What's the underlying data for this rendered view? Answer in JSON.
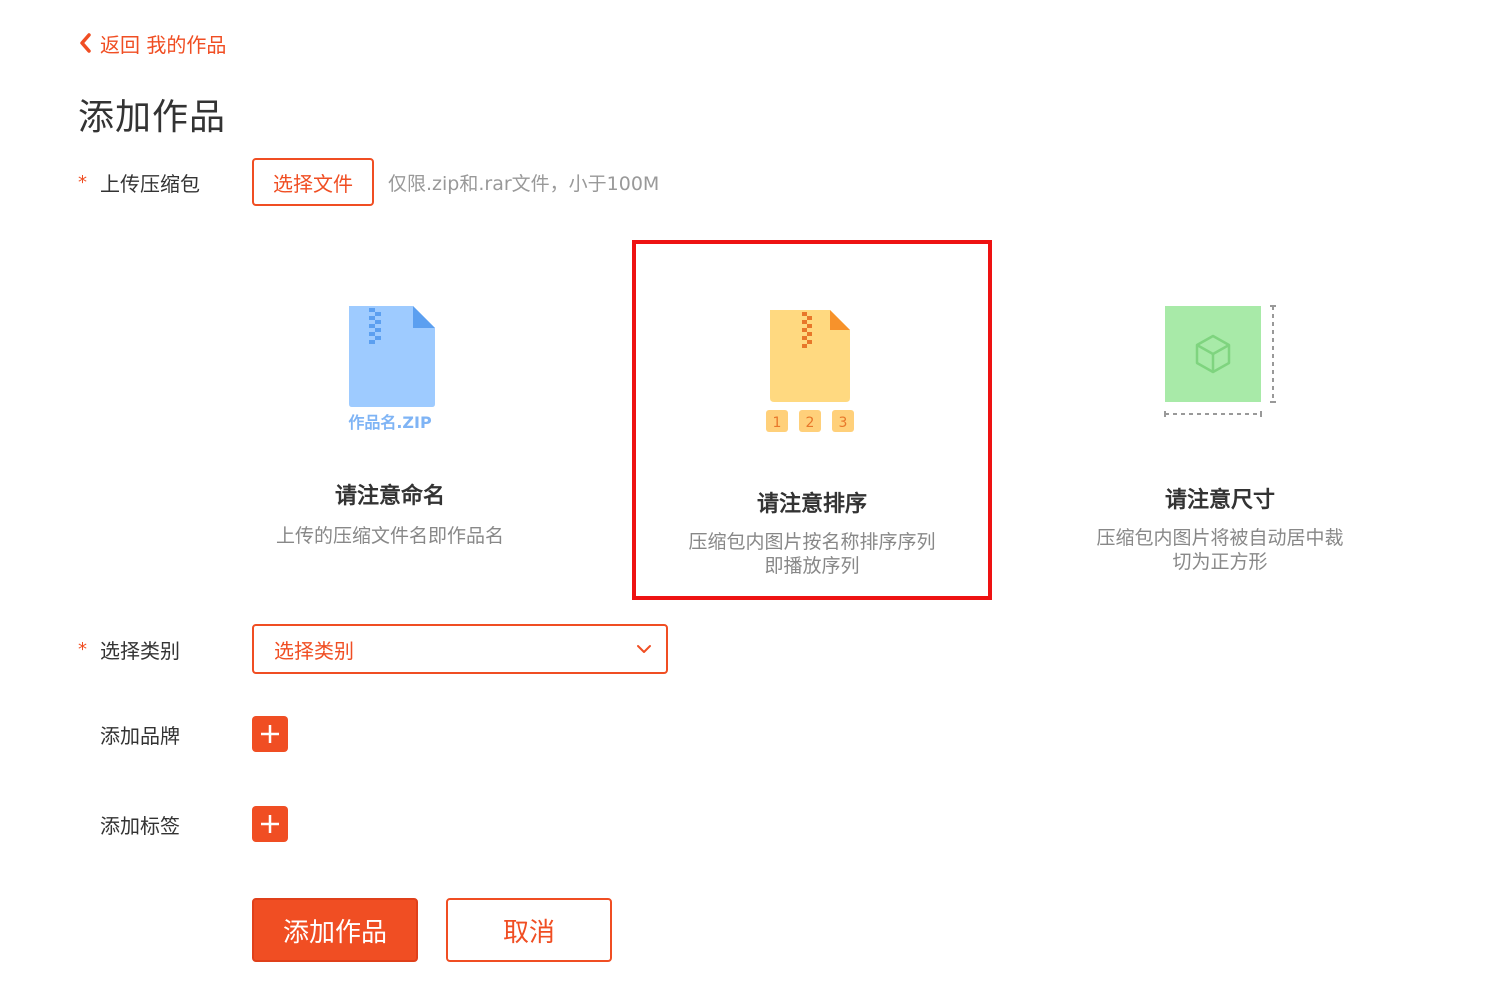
{
  "nav": {
    "back_label": "返回 我的作品"
  },
  "page": {
    "title": "添加作品"
  },
  "upload": {
    "required_mark": "*",
    "label": "上传压缩包",
    "button_label": "选择文件",
    "hint": "仅限.zip和.rar文件，小于100M"
  },
  "tips": [
    {
      "icon": "zip-file-icon",
      "icon_caption": "作品名.ZIP",
      "title": "请注意命名",
      "desc": [
        "上传的压缩文件名即作品名"
      ],
      "color": "#9ecbff"
    },
    {
      "icon": "zip-sequence-icon",
      "numbers": [
        "1",
        "2",
        "3"
      ],
      "title": "请注意排序",
      "desc": [
        "压缩包内图片按名称排序序列",
        "即播放序列"
      ],
      "color": "#ffd980",
      "highlighted": true
    },
    {
      "icon": "square-crop-icon",
      "title": "请注意尺寸",
      "desc": [
        "压缩包内图片将被自动居中裁",
        "切为正方形"
      ],
      "color": "#a8eaa8"
    }
  ],
  "category": {
    "required_mark": "*",
    "label": "选择类别",
    "selected": "选择类别"
  },
  "brand": {
    "label": "添加品牌"
  },
  "tags": {
    "label": "添加标签"
  },
  "actions": {
    "submit_label": "添加作品",
    "cancel_label": "取消"
  },
  "colors": {
    "accent": "#f04e23",
    "highlight_border": "#ee1212"
  }
}
